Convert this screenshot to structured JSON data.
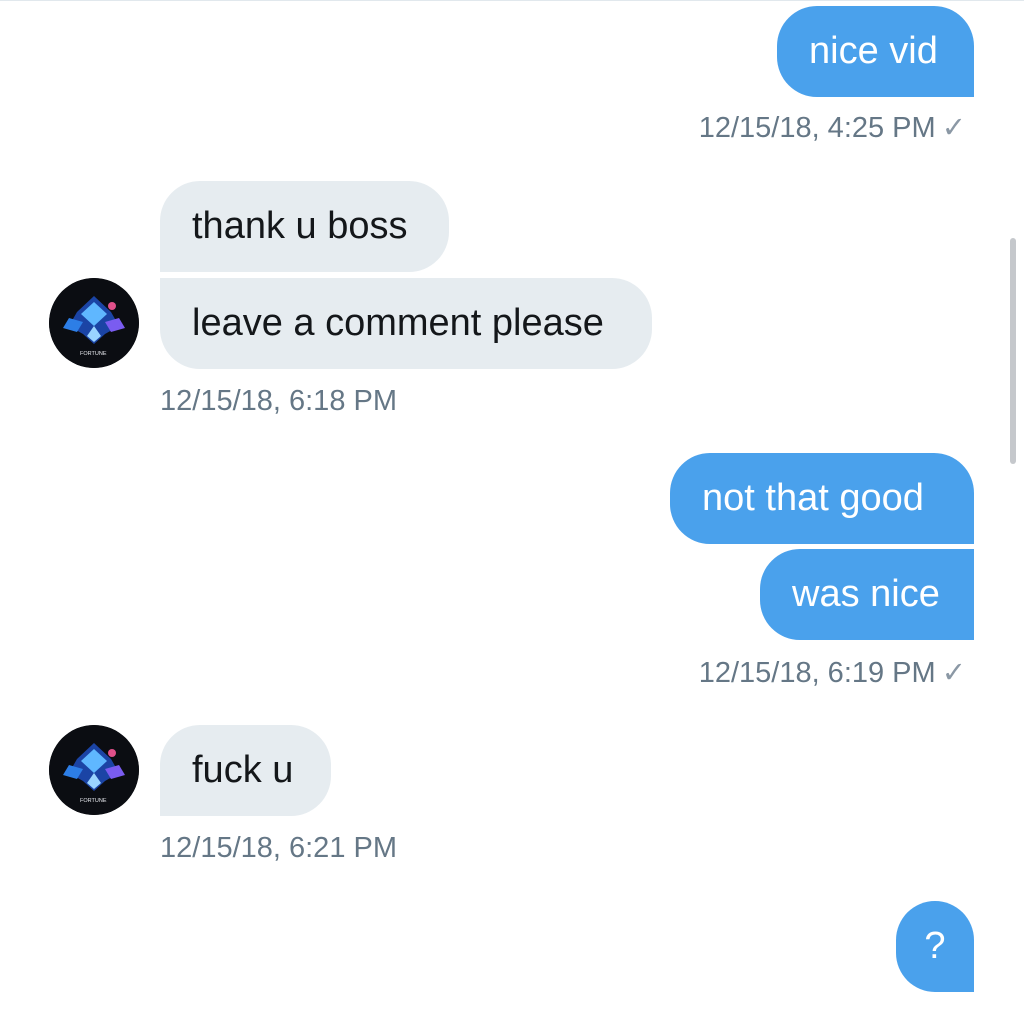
{
  "conversation": {
    "messages": [
      {
        "direction": "outgoing",
        "text": "nice vid"
      },
      {
        "direction": "incoming",
        "text": "thank u boss"
      },
      {
        "direction": "incoming",
        "text": "leave a comment please"
      },
      {
        "direction": "outgoing",
        "text": "not that good"
      },
      {
        "direction": "outgoing",
        "text": "was nice"
      },
      {
        "direction": "incoming",
        "text": "fuck u"
      },
      {
        "direction": "outgoing",
        "text": "?"
      }
    ],
    "timestamps": [
      {
        "text": "12/15/18, 4:25 PM",
        "read_check": "✓"
      },
      {
        "text": "12/15/18, 6:18 PM"
      },
      {
        "text": "12/15/18, 6:19 PM",
        "read_check": "✓"
      },
      {
        "text": "12/15/18, 6:21 PM"
      }
    ]
  },
  "contact": {
    "avatar_icon": "contact-avatar-icon",
    "avatar_caption": "FORTUNE"
  },
  "colors": {
    "outgoing_bubble": "#4aa1ec",
    "incoming_bubble": "#e6ecf0",
    "timestamp_text": "#657786"
  }
}
